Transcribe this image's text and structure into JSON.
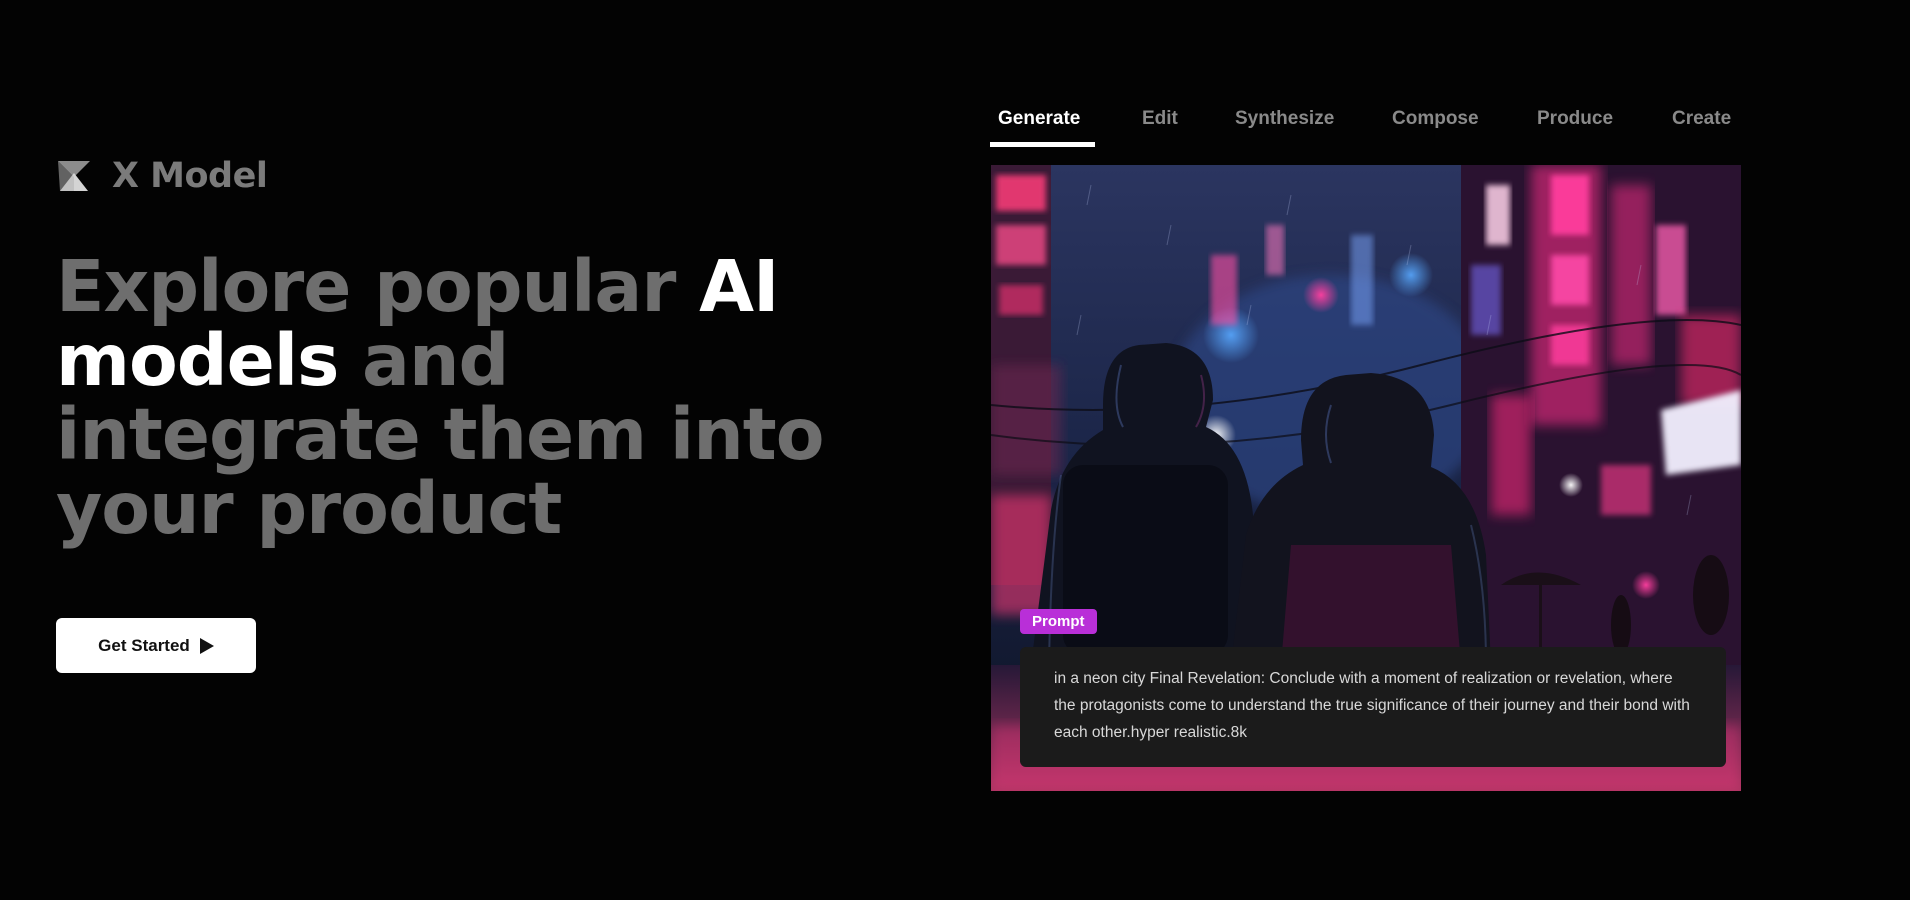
{
  "brand": {
    "name": "X Model",
    "icon": "hourglass-logo-icon"
  },
  "hero": {
    "headline_parts": [
      {
        "text": "Explore popular ",
        "highlight": false
      },
      {
        "text": "AI models",
        "highlight": true
      },
      {
        "text": " and integrate them into your product",
        "highlight": false
      }
    ],
    "cta_label": "Get Started",
    "cta_icon": "play-icon"
  },
  "tabs": {
    "items": [
      "Generate",
      "Edit",
      "Synthesize",
      "Compose",
      "Produce",
      "Create"
    ],
    "active": "Generate"
  },
  "showcase": {
    "image_alt": "two hooded figures walking in a rainy neon city street",
    "prompt_tag": "Prompt",
    "prompt_text": "in a neon city Final Revelation: Conclude with a moment of realization or revelation, where the protagonists come to understand the true significance of their journey and their bond with each other.hyper realistic.8k"
  },
  "colors": {
    "background": "#030303",
    "muted_text": "#6e6e6e",
    "highlight_text": "#ffffff",
    "tag_accent": "#b92fd8",
    "prompt_box": "#1b1b1b"
  }
}
